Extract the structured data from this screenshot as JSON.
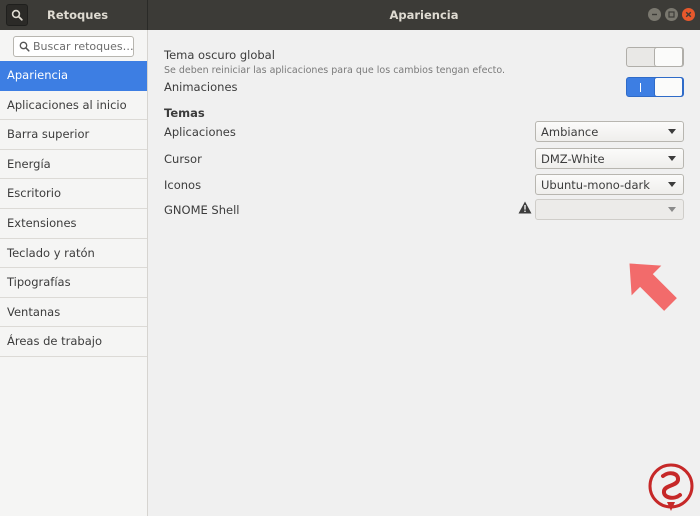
{
  "app": {
    "title": "Retoques",
    "window_title": "Apariencia"
  },
  "sidebar": {
    "search_placeholder": "Buscar retoques…",
    "items": [
      {
        "label": "Apariencia",
        "active": true
      },
      {
        "label": "Aplicaciones al inicio"
      },
      {
        "label": "Barra superior"
      },
      {
        "label": "Energía"
      },
      {
        "label": "Escritorio"
      },
      {
        "label": "Extensiones"
      },
      {
        "label": "Teclado y ratón"
      },
      {
        "label": "Tipografías"
      },
      {
        "label": "Ventanas"
      },
      {
        "label": "Áreas de trabajo"
      }
    ]
  },
  "main": {
    "dark_theme": {
      "label": "Tema oscuro global",
      "hint": "Se deben reiniciar las aplicaciones para que los cambios tengan efecto.",
      "enabled": false
    },
    "animations": {
      "label": "Animaciones",
      "enabled": true
    },
    "themes_heading": "Temas",
    "themes": [
      {
        "label": "Aplicaciones",
        "value": "Ambiance"
      },
      {
        "label": "Cursor",
        "value": "DMZ-White"
      },
      {
        "label": "Iconos",
        "value": "Ubuntu-mono-dark"
      },
      {
        "label": "GNOME Shell",
        "value": "",
        "disabled": true,
        "warning_icon": "warning-icon"
      }
    ]
  },
  "colors": {
    "accent": "#3d7ee3",
    "titlebar": "#3c3b37",
    "close_button": "#e6582c",
    "pointer_arrow": "#f26b6b",
    "watermark": "#c62828"
  }
}
